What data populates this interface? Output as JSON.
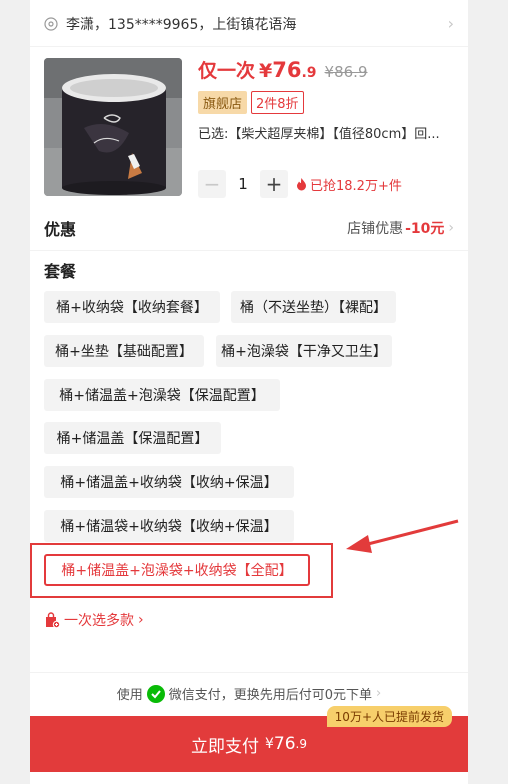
{
  "address": {
    "text": "李潇，135****9965，上街镇花语海",
    "chevron": "›",
    "pin_icon": "location-pin-icon"
  },
  "product": {
    "price_prefix": "仅一次",
    "currency": "¥",
    "price_int": "76",
    "price_dec": ".9",
    "original_price": "¥86.9",
    "badge_store": "旗舰店",
    "badge_discount": "2件8折",
    "selected_spec": "已选:【柴犬超厚夹棉】【值径80cm】回...",
    "quantity": "1",
    "minus": "−",
    "plus": "+",
    "hot_text": "已抢18.2万+件"
  },
  "promo": {
    "label": "优惠",
    "value_prefix": "店铺优惠",
    "value_amount": "-10元",
    "chevron": "›"
  },
  "package": {
    "title": "套餐",
    "options": [
      "桶+收纳袋【收纳套餐】",
      "桶（不送坐垫）【裸配】",
      "桶+坐垫【基础配置】",
      "桶+泡澡袋【干净又卫生】",
      "桶+储温盖+泡澡袋【保温配置】",
      "桶+储温盖【保温配置】",
      "桶+储温盖+收纳袋【收纳+保温】",
      "桶+储温袋+收纳袋【收纳+保温】",
      "桶+储温盖+泡澡袋+收纳袋【全配】"
    ],
    "selected_index": 8
  },
  "multi_select": {
    "label": "一次选多款",
    "chevron": "›"
  },
  "payment": {
    "hint_prefix": "使用",
    "hint_suffix": "微信支付，更换先用后付可0元下单",
    "chevron": "›",
    "button_label": "立即支付",
    "currency": "¥",
    "price_int": "76",
    "price_dec": ".9",
    "ship_tag": "10万+人已提前发货"
  },
  "colors": {
    "accent": "#e4393c",
    "pay_button": "#e23b3b",
    "store_badge": "#f7d9a8",
    "ship_tag": "#f7cf6b",
    "wechat": "#09bb07"
  }
}
